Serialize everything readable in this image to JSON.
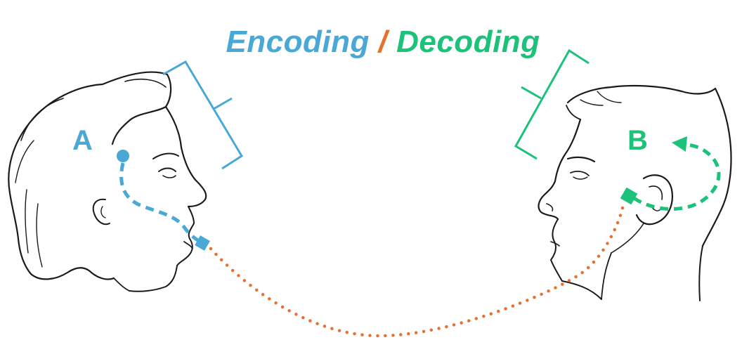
{
  "title": {
    "encoding": "Encoding",
    "separator": "/",
    "decoding": "Decoding"
  },
  "labels": {
    "sender": "A",
    "receiver": "B"
  },
  "colors": {
    "encoding": "#4aa8d6",
    "separator": "#e8702f",
    "decoding": "#1cc27a",
    "outline": "#1a1a1a"
  }
}
